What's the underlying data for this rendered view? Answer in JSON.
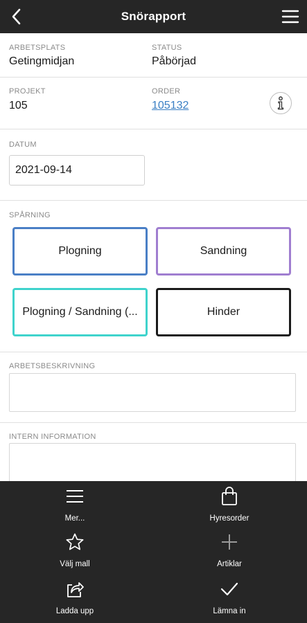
{
  "header": {
    "title": "Snörapport",
    "back_icon": "back-chevron-icon",
    "menu_icon": "hamburger-menu-icon"
  },
  "workplace": {
    "label": "ARBETSPLATS",
    "value": "Getingmidjan"
  },
  "status": {
    "label": "STATUS",
    "value": "Påbörjad"
  },
  "project": {
    "label": "PROJEKT",
    "value": "105"
  },
  "order": {
    "label": "ORDER",
    "value": "105132"
  },
  "date": {
    "label": "DATUM",
    "value": "2021-09-14"
  },
  "tracking": {
    "label": "SPÅRNING",
    "buttons": [
      {
        "label": "Plogning",
        "color": "#4a7fc6"
      },
      {
        "label": "Sandning",
        "color": "#a07ed0"
      },
      {
        "label": "Plogning / Sandning (...",
        "color": "#3fd3cc"
      },
      {
        "label": "Hinder",
        "color": "#1a1a1a"
      }
    ]
  },
  "work_description": {
    "label": "ARBETSBESKRIVNING",
    "value": ""
  },
  "internal_info": {
    "label": "INTERN INFORMATION",
    "value": ""
  },
  "actions": [
    {
      "label": "Mer...",
      "icon": "menu-lines-icon"
    },
    {
      "label": "Hyresorder",
      "icon": "shopping-bag-icon"
    },
    {
      "label": "Välj mall",
      "icon": "star-icon"
    },
    {
      "label": "Artiklar",
      "icon": "plus-icon"
    },
    {
      "label": "Ladda upp",
      "icon": "share-upload-icon"
    },
    {
      "label": "Lämna in",
      "icon": "checkmark-icon"
    }
  ],
  "colors": {
    "toolbar_bg": "#262626",
    "link": "#3a7fc4",
    "label_gray": "#8a8a8a"
  }
}
